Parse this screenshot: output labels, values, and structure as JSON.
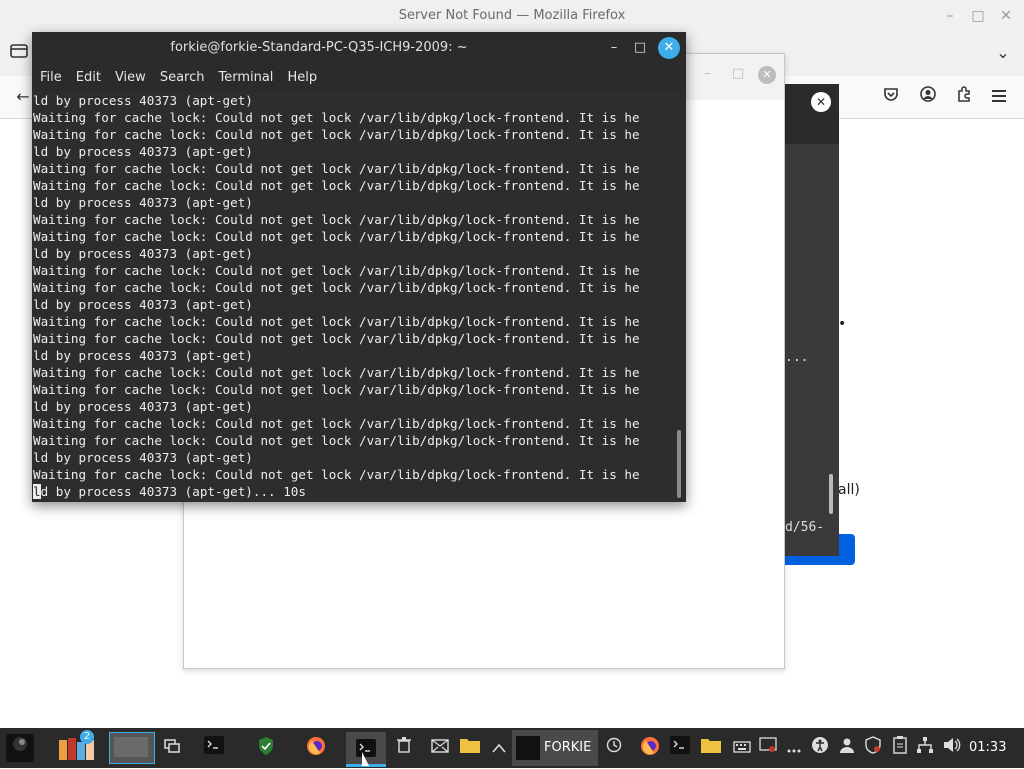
{
  "firefox": {
    "title": "Server Not Found — Mozilla Firefox",
    "minimize": "–",
    "maximize": "□",
    "close": "✕",
    "tab_list_icon": "⌄",
    "back_icon": "←",
    "toolbar_icons": [
      "pocket-icon",
      "account-icon",
      "extensions-icon",
      "menu-icon"
    ]
  },
  "dialog_behind": {
    "minimize": "–",
    "maximize": "□",
    "close": "✕"
  },
  "dialog_right": {
    "close": "✕",
    "text_dots": "...",
    "text_path": "d/56-"
  },
  "page_fragments": {
    "all_text": "all)",
    "bullet": "•"
  },
  "terminal": {
    "title": "forkie@forkie-Standard-PC-Q35-ICH9-2009: ~",
    "minimize": "–",
    "maximize": "□",
    "close": "✕",
    "menu": [
      "File",
      "Edit",
      "View",
      "Search",
      "Terminal",
      "Help"
    ],
    "lines": [
      "ld by process 40373 (apt-get)",
      "Waiting for cache lock: Could not get lock /var/lib/dpkg/lock-frontend. It is he",
      "Waiting for cache lock: Could not get lock /var/lib/dpkg/lock-frontend. It is he",
      "ld by process 40373 (apt-get)",
      "Waiting for cache lock: Could not get lock /var/lib/dpkg/lock-frontend. It is he",
      "Waiting for cache lock: Could not get lock /var/lib/dpkg/lock-frontend. It is he",
      "ld by process 40373 (apt-get)",
      "Waiting for cache lock: Could not get lock /var/lib/dpkg/lock-frontend. It is he",
      "Waiting for cache lock: Could not get lock /var/lib/dpkg/lock-frontend. It is he",
      "ld by process 40373 (apt-get)",
      "Waiting for cache lock: Could not get lock /var/lib/dpkg/lock-frontend. It is he",
      "Waiting for cache lock: Could not get lock /var/lib/dpkg/lock-frontend. It is he",
      "ld by process 40373 (apt-get)",
      "Waiting for cache lock: Could not get lock /var/lib/dpkg/lock-frontend. It is he",
      "Waiting for cache lock: Could not get lock /var/lib/dpkg/lock-frontend. It is he",
      "ld by process 40373 (apt-get)",
      "Waiting for cache lock: Could not get lock /var/lib/dpkg/lock-frontend. It is he",
      "Waiting for cache lock: Could not get lock /var/lib/dpkg/lock-frontend. It is he",
      "ld by process 40373 (apt-get)",
      "Waiting for cache lock: Could not get lock /var/lib/dpkg/lock-frontend. It is he",
      "Waiting for cache lock: Could not get lock /var/lib/dpkg/lock-frontend. It is he",
      "ld by process 40373 (apt-get)",
      "Waiting for cache lock: Could not get lock /var/lib/dpkg/lock-frontend. It is he"
    ],
    "last_line_cursor_char": "l",
    "last_line_rest": "d by process 40373 (apt-get)... 10s"
  },
  "taskbar": {
    "badge": "2",
    "forkie_label": "FORKIE",
    "clock": "01:33",
    "icons": [
      "app-menu-icon",
      "files-group-icon",
      "workspace-preview-icon",
      "show-desktop-icon",
      "terminal-icon",
      "shield-icon",
      "firefox-icon",
      "terminal-active-icon",
      "trash-icon",
      "mail-icon",
      "folder-icon",
      "tray-expand-icon",
      "forkie-window-icon",
      "clock-icon",
      "firefox-icon-2",
      "terminal-icon-2",
      "folder-icon-2",
      "keyboard-icon",
      "screenshot-icon",
      "more-icon",
      "accessibility-icon",
      "user-icon",
      "security-icon",
      "clipboard-icon",
      "network-icon",
      "volume-icon"
    ]
  },
  "colors": {
    "terminal_bg": "#2d2d2d",
    "terminal_text": "#ededed",
    "taskbar_bg": "#2a2a2a",
    "accent": "#3daee9",
    "firefox_button": "#0061e0"
  }
}
